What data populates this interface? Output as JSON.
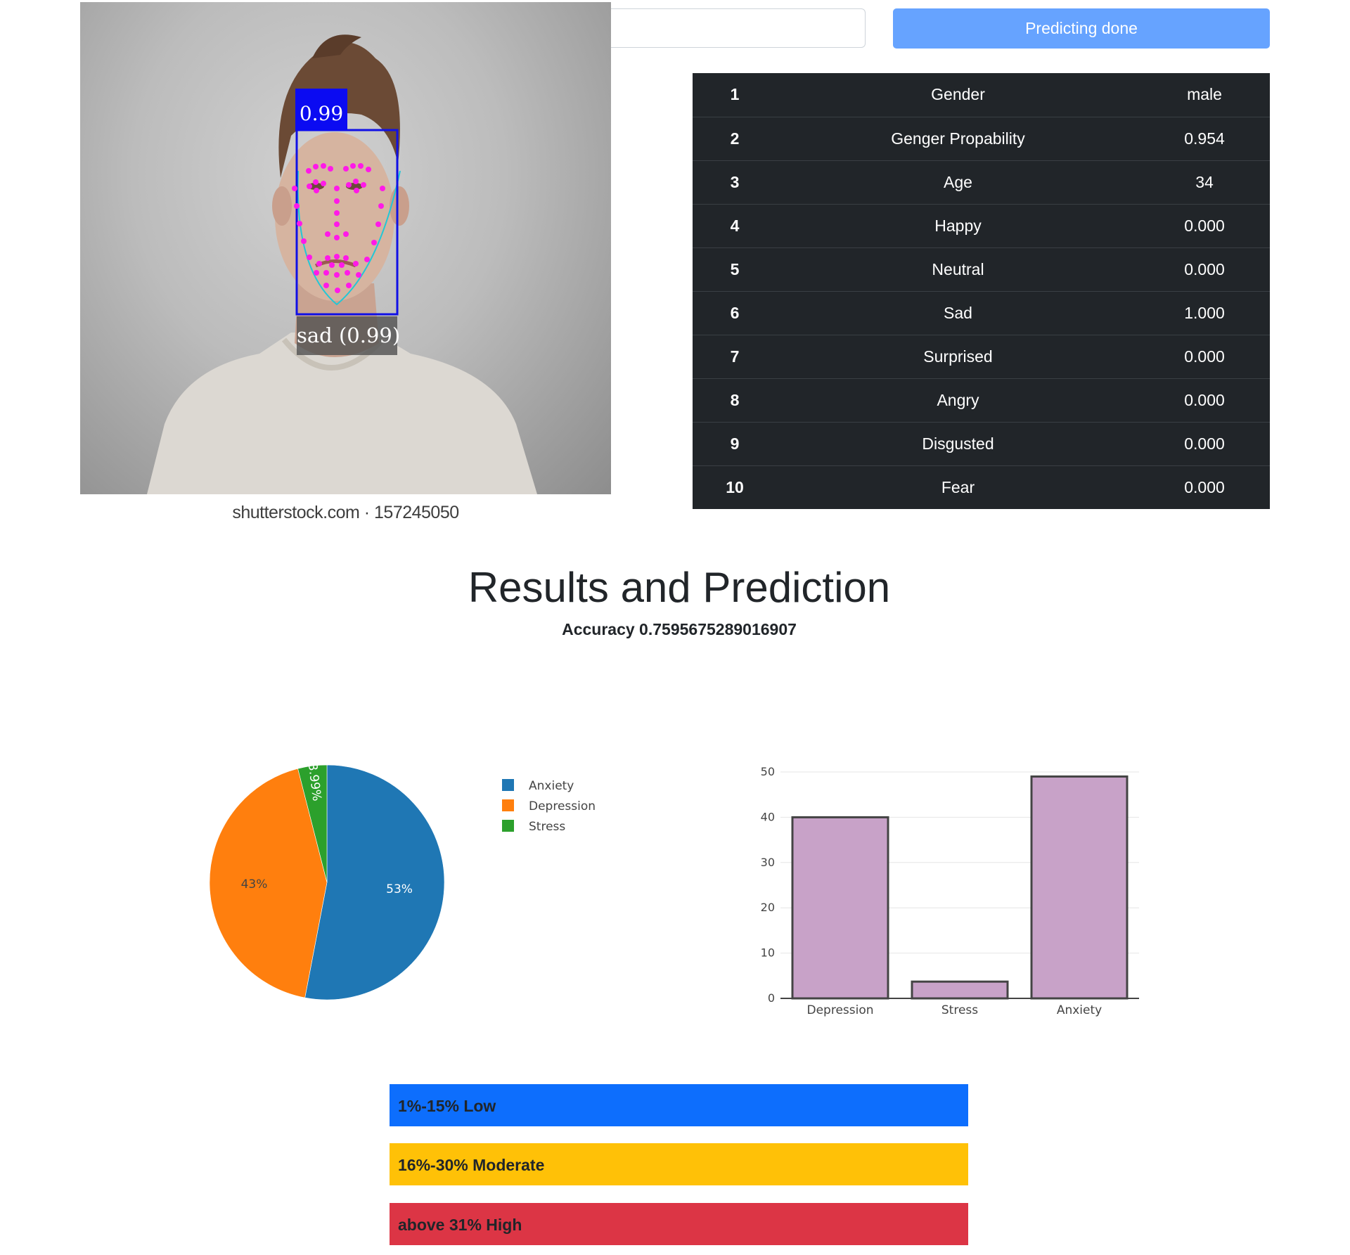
{
  "toolbar": {
    "predict_label": "Predicting done"
  },
  "photo": {
    "caption": "shutterstock.com · 157245050",
    "face_confidence": "0.99",
    "face_emotion": "sad (0.99)"
  },
  "attributes": [
    {
      "idx": "1",
      "label": "Gender",
      "value": "male"
    },
    {
      "idx": "2",
      "label": "Genger Propability",
      "value": "0.954"
    },
    {
      "idx": "3",
      "label": "Age",
      "value": "34"
    },
    {
      "idx": "4",
      "label": "Happy",
      "value": "0.000"
    },
    {
      "idx": "5",
      "label": "Neutral",
      "value": "0.000"
    },
    {
      "idx": "6",
      "label": "Sad",
      "value": "1.000"
    },
    {
      "idx": "7",
      "label": "Surprised",
      "value": "0.000"
    },
    {
      "idx": "8",
      "label": "Angry",
      "value": "0.000"
    },
    {
      "idx": "9",
      "label": "Disgusted",
      "value": "0.000"
    },
    {
      "idx": "10",
      "label": "Fear",
      "value": "0.000"
    }
  ],
  "results": {
    "title": "Results and Prediction",
    "accuracy": "Accuracy 0.7595675289016907"
  },
  "chart_data": [
    {
      "type": "pie",
      "labels": [
        "Anxiety",
        "Depression",
        "Stress"
      ],
      "values": [
        53,
        43,
        3.99
      ],
      "slice_labels": [
        "53%",
        "43%",
        "3.99%"
      ],
      "colors": [
        "#1f77b4",
        "#ff7f0e",
        "#2ca02c"
      ],
      "legend_position": "right"
    },
    {
      "type": "bar",
      "categories": [
        "Depression",
        "Stress",
        "Anxiety"
      ],
      "values": [
        40,
        3.7,
        49
      ],
      "ylim": [
        0,
        50
      ],
      "yticks": [
        "0",
        "10",
        "20",
        "30",
        "40",
        "50"
      ],
      "bar_color": "#c8a2c8",
      "bar_edge_color": "#444444",
      "grid": true
    }
  ],
  "levels": {
    "low": "1%-15% Low",
    "moderate": "16%-30% Moderate",
    "high": "above 31% High"
  }
}
